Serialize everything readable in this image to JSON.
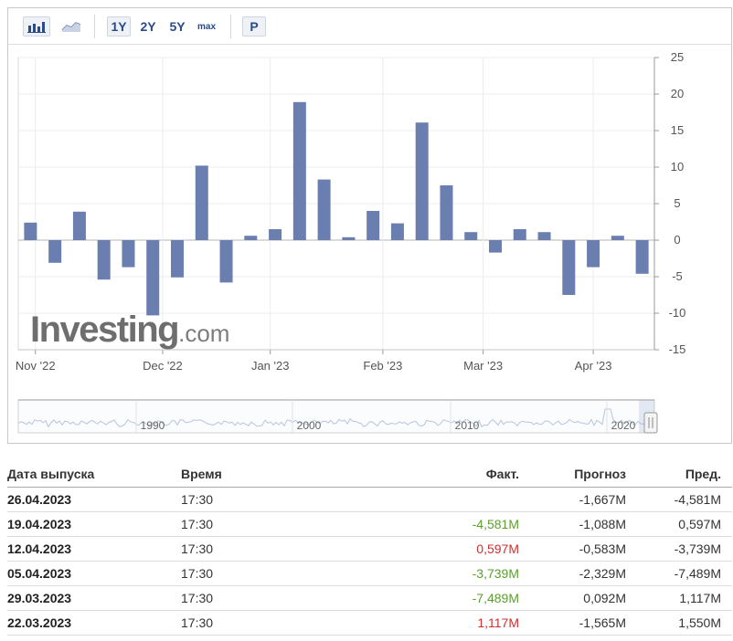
{
  "toolbar": {
    "bar_chart_icon": "bar-chart-icon",
    "line_chart_icon": "line-chart-icon",
    "ranges": [
      "1Y",
      "2Y",
      "5Y",
      "max"
    ],
    "p_label": "P"
  },
  "watermark": {
    "brand": "Investing",
    "suffix": ".com"
  },
  "chart_data": {
    "type": "bar",
    "bar_color": "#6b7eb0",
    "values": [
      2.4,
      -3.1,
      3.9,
      -5.4,
      -3.7,
      -10.3,
      -5.1,
      10.2,
      -5.8,
      0.6,
      1.5,
      18.9,
      8.3,
      0.4,
      4.0,
      2.3,
      16.1,
      7.5,
      1.1,
      -1.7,
      1.5,
      1.1,
      -7.5,
      -3.7,
      0.6,
      -4.6
    ],
    "ylim": [
      -15,
      25
    ],
    "yticks": [
      "25",
      "20",
      "15",
      "10",
      "5",
      "0",
      "-5",
      "-10",
      "-15"
    ],
    "xticks": [
      {
        "label": "Nov '22",
        "at": 0.2
      },
      {
        "label": "Dec '22",
        "at": 5.4
      },
      {
        "label": "Jan '23",
        "at": 9.8
      },
      {
        "label": "Feb '23",
        "at": 14.4
      },
      {
        "label": "Mar '23",
        "at": 18.5
      },
      {
        "label": "Apr '23",
        "at": 23.0
      }
    ],
    "grid": true,
    "navigator_years": [
      "1990",
      "2000",
      "2010",
      "2020"
    ]
  },
  "table": {
    "headers": [
      "Дата выпуска",
      "Время",
      "Факт.",
      "Прогноз",
      "Пред."
    ],
    "rows": [
      {
        "date": "26.04.2023",
        "time": "17:30",
        "actual": "",
        "actual_color": "",
        "forecast": "-1,667M",
        "previous": "-4,581M"
      },
      {
        "date": "19.04.2023",
        "time": "17:30",
        "actual": "-4,581M",
        "actual_color": "pos",
        "forecast": "-1,088M",
        "previous": "0,597M"
      },
      {
        "date": "12.04.2023",
        "time": "17:30",
        "actual": "0,597M",
        "actual_color": "neg",
        "forecast": "-0,583M",
        "previous": "-3,739M"
      },
      {
        "date": "05.04.2023",
        "time": "17:30",
        "actual": "-3,739M",
        "actual_color": "pos",
        "forecast": "-2,329M",
        "previous": "-7,489M"
      },
      {
        "date": "29.03.2023",
        "time": "17:30",
        "actual": "-7,489M",
        "actual_color": "pos",
        "forecast": "0,092M",
        "previous": "1,117M"
      },
      {
        "date": "22.03.2023",
        "time": "17:30",
        "actual": "1,117M",
        "actual_color": "neg",
        "forecast": "-1,565M",
        "previous": "1,550M"
      }
    ]
  }
}
